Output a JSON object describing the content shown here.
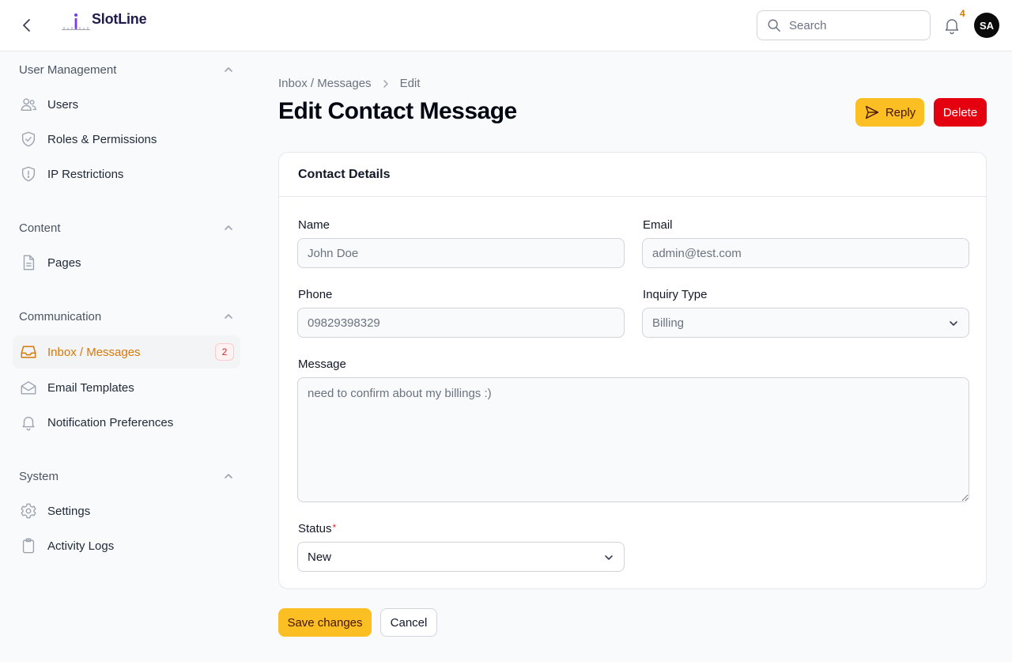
{
  "app": {
    "name": "SlotLine"
  },
  "header": {
    "search_placeholder": "Search",
    "notification_count": "4",
    "avatar_initials": "SA"
  },
  "sidebar": {
    "groups": [
      {
        "title": "User Management",
        "items": [
          {
            "label": "Users",
            "icon": "users-icon"
          },
          {
            "label": "Roles & Permissions",
            "icon": "shield-check-icon"
          },
          {
            "label": "IP Restrictions",
            "icon": "shield-exclamation-icon"
          }
        ]
      },
      {
        "title": "Content",
        "items": [
          {
            "label": "Pages",
            "icon": "document-icon"
          }
        ]
      },
      {
        "title": "Communication",
        "items": [
          {
            "label": "Inbox / Messages",
            "icon": "inbox-icon",
            "badge": "2",
            "active": true
          },
          {
            "label": "Email Templates",
            "icon": "envelope-open-icon"
          },
          {
            "label": "Notification Preferences",
            "icon": "bell-icon"
          }
        ]
      },
      {
        "title": "System",
        "items": [
          {
            "label": "Settings",
            "icon": "gear-icon"
          },
          {
            "label": "Activity Logs",
            "icon": "clipboard-icon"
          }
        ]
      }
    ]
  },
  "breadcrumb": {
    "parent": "Inbox / Messages",
    "current": "Edit"
  },
  "page": {
    "title": "Edit Contact Message",
    "reply_label": "Reply",
    "delete_label": "Delete"
  },
  "form": {
    "section_title": "Contact Details",
    "name": {
      "label": "Name",
      "value": "John Doe"
    },
    "email": {
      "label": "Email",
      "value": "admin@test.com"
    },
    "phone": {
      "label": "Phone",
      "value": "09829398329"
    },
    "inquiry_type": {
      "label": "Inquiry Type",
      "value": "Billing"
    },
    "message": {
      "label": "Message",
      "value": "need to confirm about my billings :)"
    },
    "status": {
      "label": "Status",
      "required_mark": "*",
      "value": "New"
    },
    "save_label": "Save changes",
    "cancel_label": "Cancel"
  },
  "colors": {
    "accent": "#fbbf24",
    "active_text": "#d97706",
    "danger": "#e5000f",
    "brand": "#1e1b4b"
  }
}
